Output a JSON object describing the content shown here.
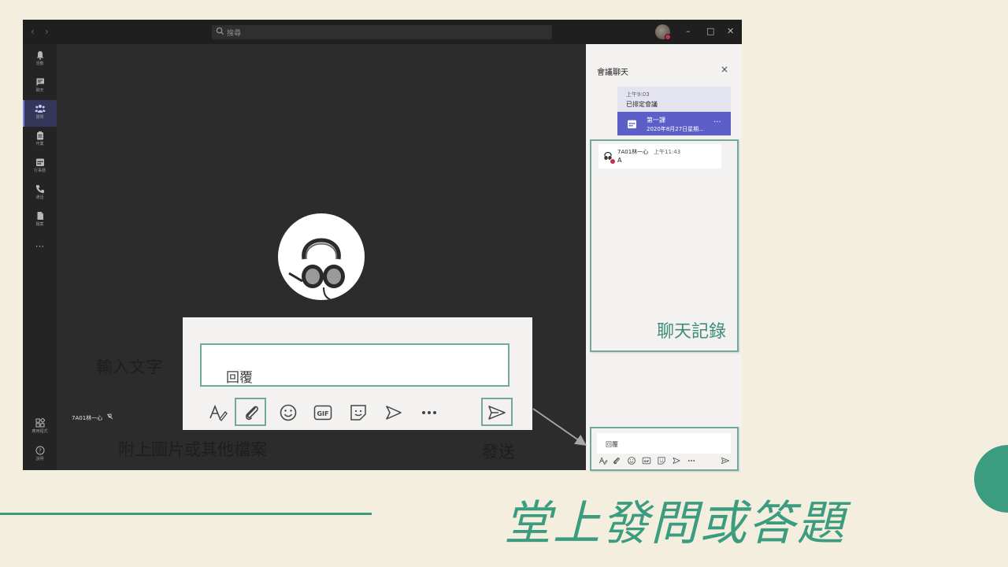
{
  "window": {
    "search_placeholder": "搜尋",
    "rail": [
      {
        "label": "活動",
        "icon": "bell-icon"
      },
      {
        "label": "聊天",
        "icon": "chat-icon"
      },
      {
        "label": "團隊",
        "icon": "teams-icon"
      },
      {
        "label": "作業",
        "icon": "assignments-icon"
      },
      {
        "label": "行事曆",
        "icon": "calendar-icon"
      },
      {
        "label": "通話",
        "icon": "phone-icon"
      },
      {
        "label": "檔案",
        "icon": "file-icon"
      }
    ],
    "rail_more": "···",
    "rail_bottom": [
      {
        "label": "應用程式",
        "icon": "apps-icon"
      },
      {
        "label": "說明",
        "icon": "help-icon"
      }
    ]
  },
  "meeting": {
    "participant_name": "7A01林一心"
  },
  "chat": {
    "title": "會議聊天",
    "close": "×",
    "meeting_card": {
      "time": "上午9:03",
      "message": "已排定會議",
      "title": "第一課",
      "date": "2020年8月27日星期...",
      "more": "···"
    },
    "message": {
      "sender": "7A01林一心",
      "time": "上午11:43",
      "text": "A"
    },
    "compose_placeholder": "回覆"
  },
  "annotations": {
    "chat_history": "聊天記錄",
    "input_text": "輸入文字",
    "attach": "附上圖片或其他檔案",
    "send": "發送",
    "reply_placeholder": "回覆"
  },
  "toolbar_icons": [
    "format-icon",
    "attach-icon",
    "emoji-icon",
    "gif-icon",
    "sticker-icon",
    "meet-now-icon",
    "more-icon",
    "send-icon"
  ],
  "gif_label": "GIF",
  "slide_title": "堂上發問或答題",
  "colors": {
    "background": "#f4eedf",
    "accent_green": "#3c9c7f",
    "callout_border": "#73a99b",
    "teams_purple": "#5b5fc7",
    "presence_red": "#c4314b"
  }
}
